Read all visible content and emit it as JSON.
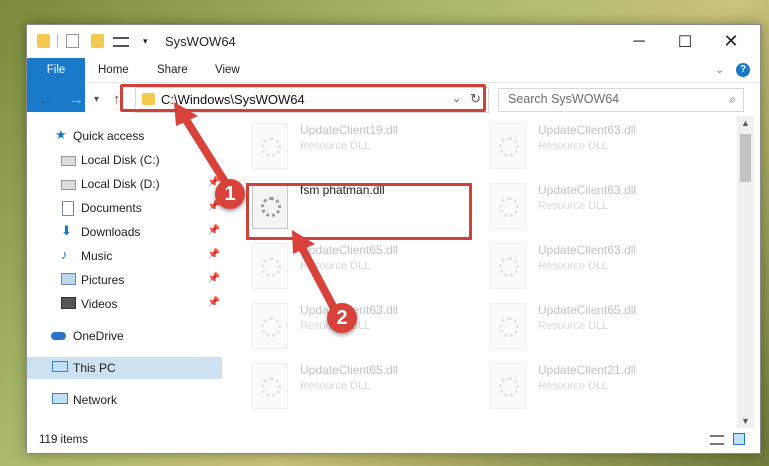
{
  "window": {
    "title": "SysWOW64"
  },
  "ribbon": {
    "tabs": [
      "File",
      "Home",
      "Share",
      "View"
    ]
  },
  "address": {
    "path": "C:\\Windows\\SysWOW64",
    "search_placeholder": "Search SysWOW64"
  },
  "sidebar": {
    "items": [
      {
        "label": "Quick access",
        "icon": "star-icon",
        "pinned": false
      },
      {
        "label": "Local Disk (C:)",
        "icon": "drive-icon",
        "pinned": false
      },
      {
        "label": "Local Disk (D:)",
        "icon": "drive-icon",
        "pinned": true
      },
      {
        "label": "Documents",
        "icon": "documents-icon",
        "pinned": true
      },
      {
        "label": "Downloads",
        "icon": "download-icon",
        "pinned": true
      },
      {
        "label": "Music",
        "icon": "music-icon",
        "pinned": true
      },
      {
        "label": "Pictures",
        "icon": "pictures-icon",
        "pinned": true
      },
      {
        "label": "Videos",
        "icon": "videos-icon",
        "pinned": true
      },
      {
        "label": "OneDrive",
        "icon": "cloud-icon",
        "pinned": false
      },
      {
        "label": "This PC",
        "icon": "computer-icon",
        "pinned": false
      },
      {
        "label": "Network",
        "icon": "network-icon",
        "pinned": false
      }
    ]
  },
  "files": [
    {
      "name": "UpdateClient19.dll",
      "type": "Resource DLL"
    },
    {
      "name": "UpdateClient63.dll",
      "type": "Resource DLL"
    },
    {
      "name": "fsm phatman.dll",
      "type": ""
    },
    {
      "name": "UpdateClient63.dll",
      "type": "Resource DLL"
    },
    {
      "name": "UpdateClient65.dll",
      "type": "Resource DLL"
    },
    {
      "name": "UpdateClient63.dll",
      "type": "Resource DLL"
    },
    {
      "name": "UpdateClient63.dll",
      "type": "Resource DLL"
    },
    {
      "name": "UpdateClient65.dll",
      "type": "Resource DLL"
    },
    {
      "name": "UpdateClient65.dll",
      "type": "Resource DLL"
    },
    {
      "name": "UpdateClient21.dll",
      "type": "Resource DLL"
    }
  ],
  "callouts": [
    "1",
    "2"
  ],
  "status": {
    "items": "119 items"
  },
  "colors": {
    "accent": "#1979ca",
    "highlight": "#d2403c"
  }
}
